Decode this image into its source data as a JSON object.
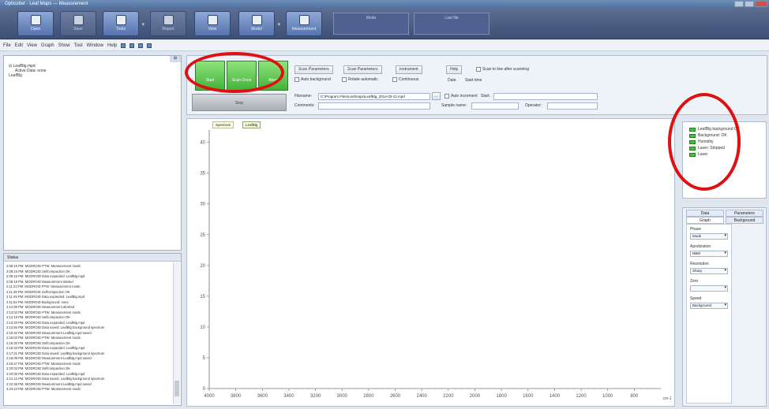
{
  "window": {
    "title": "Opticutter · Leaf Maps — Measurement"
  },
  "toolbar": {
    "buttons": [
      {
        "label": "Open",
        "icon": "folder-icon"
      },
      {
        "label": "Save",
        "icon": "save-icon"
      },
      {
        "label": "Tools",
        "icon": "tools-icon"
      },
      {
        "label": "Report",
        "icon": "report-icon"
      },
      {
        "label": "View",
        "icon": "view-icon"
      },
      {
        "label": "Model",
        "icon": "model-icon"
      },
      {
        "label": "Measurement",
        "icon": "measurement-icon"
      }
    ],
    "mode_label": "Mode",
    "file_label": "Last file"
  },
  "menu": [
    "File",
    "Edit",
    "View",
    "Graph",
    "Show",
    "Tool",
    "Window",
    "Help"
  ],
  "tree": {
    "items": [
      "LeafBlg.mpd",
      "Active Data: none",
      "LeafBlg"
    ]
  },
  "log": {
    "header": "Status",
    "lines": [
      "2:08:15 PM: MODROID PTW: Measurement mode",
      "2:08:15 PM: MODROID Selfcompaction OK",
      "2:08:16 PM: MODROID Data expanded: LeafBlg.mpd",
      "2:08:18 PM: MODROID Measurement started",
      "2:11:23 PM: MODROID PTW: Measurement mode",
      "2:11:48 PM: MODROID Selfcompaction OK",
      "2:11:49 PM: MODROID Data expanded: LeafBlg.mpd",
      "2:11:52 PM: MODROID Background: none",
      "2:12:05 PM: MODROID Measurement aborted",
      "2:13:02 PM: MODROID PTW: Measurement mode",
      "2:13:18 PM: MODROID Selfcompaction OK",
      "2:13:20 PM: MODROID Data expanded: LeafBlg.mpd",
      "2:14:55 PM: MODROID Data saved: LeafBlg background spectrum",
      "2:15:40 PM: MODROID Measurement LeafBlg.mpd saved",
      "2:16:02 PM: MODROID PTW: Measurement mode",
      "2:16:30 PM: MODROID Selfcompaction OK",
      "2:16:33 PM: MODROID Data expanded: LeafBlg.mpd",
      "2:17:21 PM: MODROID Data saved: LeafBlg background spectrum",
      "2:18:09 PM: MODROID Measurement LeafBlg.mpd saved",
      "2:19:47 PM: MODROID PTW: Measurement mode",
      "2:20:03 PM: MODROID Selfcompaction OK",
      "2:20:05 PM: MODROID Data expanded: LeafBlg.mpd",
      "2:21:12 PM: MODROID Data saved: LeafBlg background spectrum",
      "2:22:38 PM: MODROID Measurement LeafBlg.mpd saved",
      "2:23:44 PM: MODROID PTW: Measurement mode"
    ]
  },
  "acquisition": {
    "green_buttons": [
      "Start",
      "Scan Once",
      "Abort"
    ],
    "stop_label": "Stop",
    "buttons": [
      "Scan Parameters",
      "Scan Parameters",
      "Instrument",
      "Help"
    ],
    "options": [
      "Auto background",
      "Rotate automatic",
      "Continuous",
      "Scan to line after scanning"
    ],
    "filename_label": "Filename:",
    "filename_value": "C:\\Program Files\\Leafmaps\\LeafBlg_2014-03-12.mpd",
    "comment_label": "Comments:",
    "sample_label": "Sample name:",
    "sample_value": "",
    "operator_label": "Operator:",
    "operator_value": "",
    "autoincrement_label": "Auto increment",
    "start_label": "Start:",
    "start_value": "",
    "date_label": "Date",
    "time_label": "Start time"
  },
  "chart_tabs": [
    "Spectrum",
    "LeafBlg"
  ],
  "chart_data": {
    "type": "line",
    "x_range": [
      4000,
      600
    ],
    "ylim": [
      0,
      42
    ],
    "x_ticks": [
      "4000",
      "3800",
      "3600",
      "3400",
      "3200",
      "3000",
      "2800",
      "2600",
      "2400",
      "2200",
      "2000",
      "1800",
      "1600",
      "1400",
      "1200",
      "1000",
      "800"
    ],
    "y_ticks": [
      "0",
      "5",
      "10",
      "15",
      "20",
      "25",
      "30",
      "35",
      "40"
    ],
    "xlabel": "cm-1",
    "ylabel": "",
    "series": []
  },
  "legend": {
    "items": [
      "LeafBlg background OK",
      "Background: OK",
      "Humidity",
      "Laser: Stopped",
      "Laser"
    ],
    "color": "#44c23c"
  },
  "side": {
    "tabs": [
      "Data",
      "Parameters",
      "Graph",
      "Background"
    ],
    "sections": [
      {
        "label": "Phase",
        "value": "Mode"
      },
      {
        "label": "Apodization",
        "value": "NBM"
      },
      {
        "label": "Resolution",
        "value": "Sharp"
      },
      {
        "label": "Zero",
        "value": ""
      },
      {
        "label": "Speed",
        "value": "Background"
      }
    ]
  }
}
